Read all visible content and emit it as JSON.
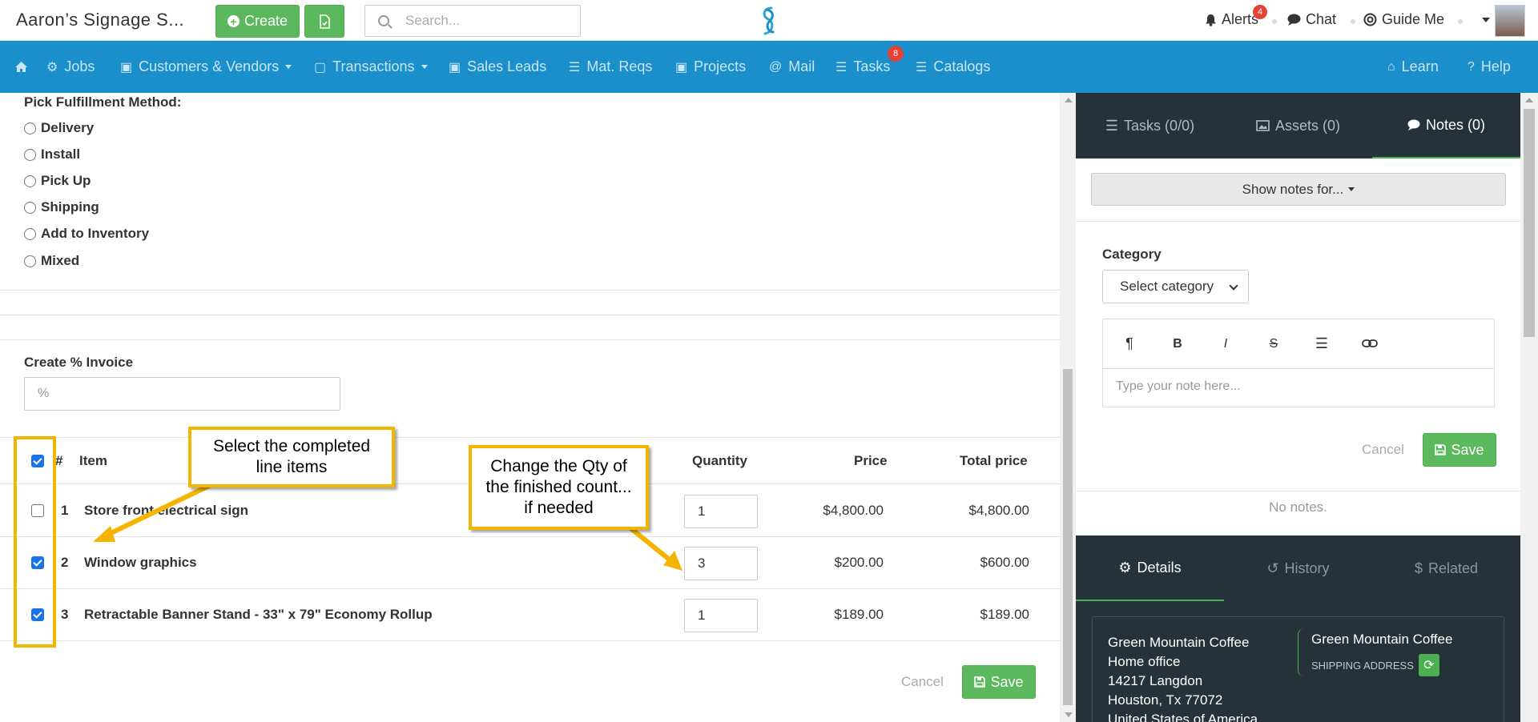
{
  "topbar": {
    "app_title": "Aaron’s Signage S...",
    "create_label": "Create",
    "search_placeholder": "Search...",
    "alerts_label": "Alerts",
    "alerts_count": "4",
    "chat_label": "Chat",
    "guide_label": "Guide Me"
  },
  "nav": {
    "items": [
      {
        "label": "Jobs",
        "icon": "cogs-icon"
      },
      {
        "label": "Customers & Vendors",
        "icon": "briefcase-icon"
      },
      {
        "label": "Transactions",
        "icon": "file-icon"
      },
      {
        "label": "Sales Leads",
        "icon": "suitcase-icon"
      },
      {
        "label": "Mat. Reqs",
        "icon": "list-icon"
      },
      {
        "label": "Projects",
        "icon": "briefcase-icon"
      },
      {
        "label": "Mail",
        "icon": "at-icon"
      },
      {
        "label": "Tasks",
        "icon": "tasks-icon"
      },
      {
        "label": "Catalogs",
        "icon": "list-icon"
      },
      {
        "label": "Learn",
        "icon": "bank-icon"
      },
      {
        "label": "Help",
        "icon": "question-icon"
      }
    ],
    "tasks_count": "8",
    "color": "#1a8fcb"
  },
  "fulfillment": {
    "title": "Pick Fulfillment Method:",
    "options": [
      "Delivery",
      "Install",
      "Pick Up",
      "Shipping",
      "Add to Inventory",
      "Mixed"
    ]
  },
  "invoice": {
    "label": "Create % Invoice",
    "placeholder": "%"
  },
  "table": {
    "headers": {
      "num": "#",
      "item": "Item",
      "quantity": "Quantity",
      "price": "Price",
      "total": "Total price"
    },
    "header_checked": true,
    "rows": [
      {
        "num": "1",
        "item": "Store front electrical sign",
        "qty": "1",
        "price": "$4,800.00",
        "total": "$4,800.00",
        "checked": false
      },
      {
        "num": "2",
        "item": "Window graphics",
        "qty": "3",
        "price": "$200.00",
        "total": "$600.00",
        "checked": true
      },
      {
        "num": "3",
        "item": "Retractable Banner Stand - 33\" x 79\" Economy Rollup",
        "qty": "1",
        "price": "$189.00",
        "total": "$189.00",
        "checked": true
      }
    ]
  },
  "callouts": {
    "select_items": "Select the completed line items",
    "change_qty": "Change the Qty of the finished count... if needed",
    "color": "#f4b400"
  },
  "form_actions": {
    "cancel": "Cancel",
    "save": "Save"
  },
  "right_panel": {
    "tabs": [
      {
        "label": "Tasks (0/0)",
        "icon": "tasks-icon"
      },
      {
        "label": "Assets (0)",
        "icon": "image-icon"
      },
      {
        "label": "Notes (0)",
        "icon": "comment-icon"
      }
    ],
    "show_notes": "Show notes for...",
    "category_label": "Category",
    "category_select": "Select category",
    "note_placeholder": "Type your note here...",
    "cancel": "Cancel",
    "save": "Save",
    "no_notes": "No notes.",
    "detail_tabs": [
      {
        "label": "Details",
        "icon": "gear-icon"
      },
      {
        "label": "History",
        "icon": "history-icon"
      },
      {
        "label": "Related",
        "icon": "dollar-icon"
      }
    ],
    "address": {
      "lines": [
        "Green Mountain Coffee",
        "Home office",
        "14217 Langdon",
        "Houston, Tx 77072",
        "United States of America"
      ],
      "shipping_name": "Green Mountain Coffee",
      "shipping_label": "SHIPPING ADDRESS"
    }
  }
}
